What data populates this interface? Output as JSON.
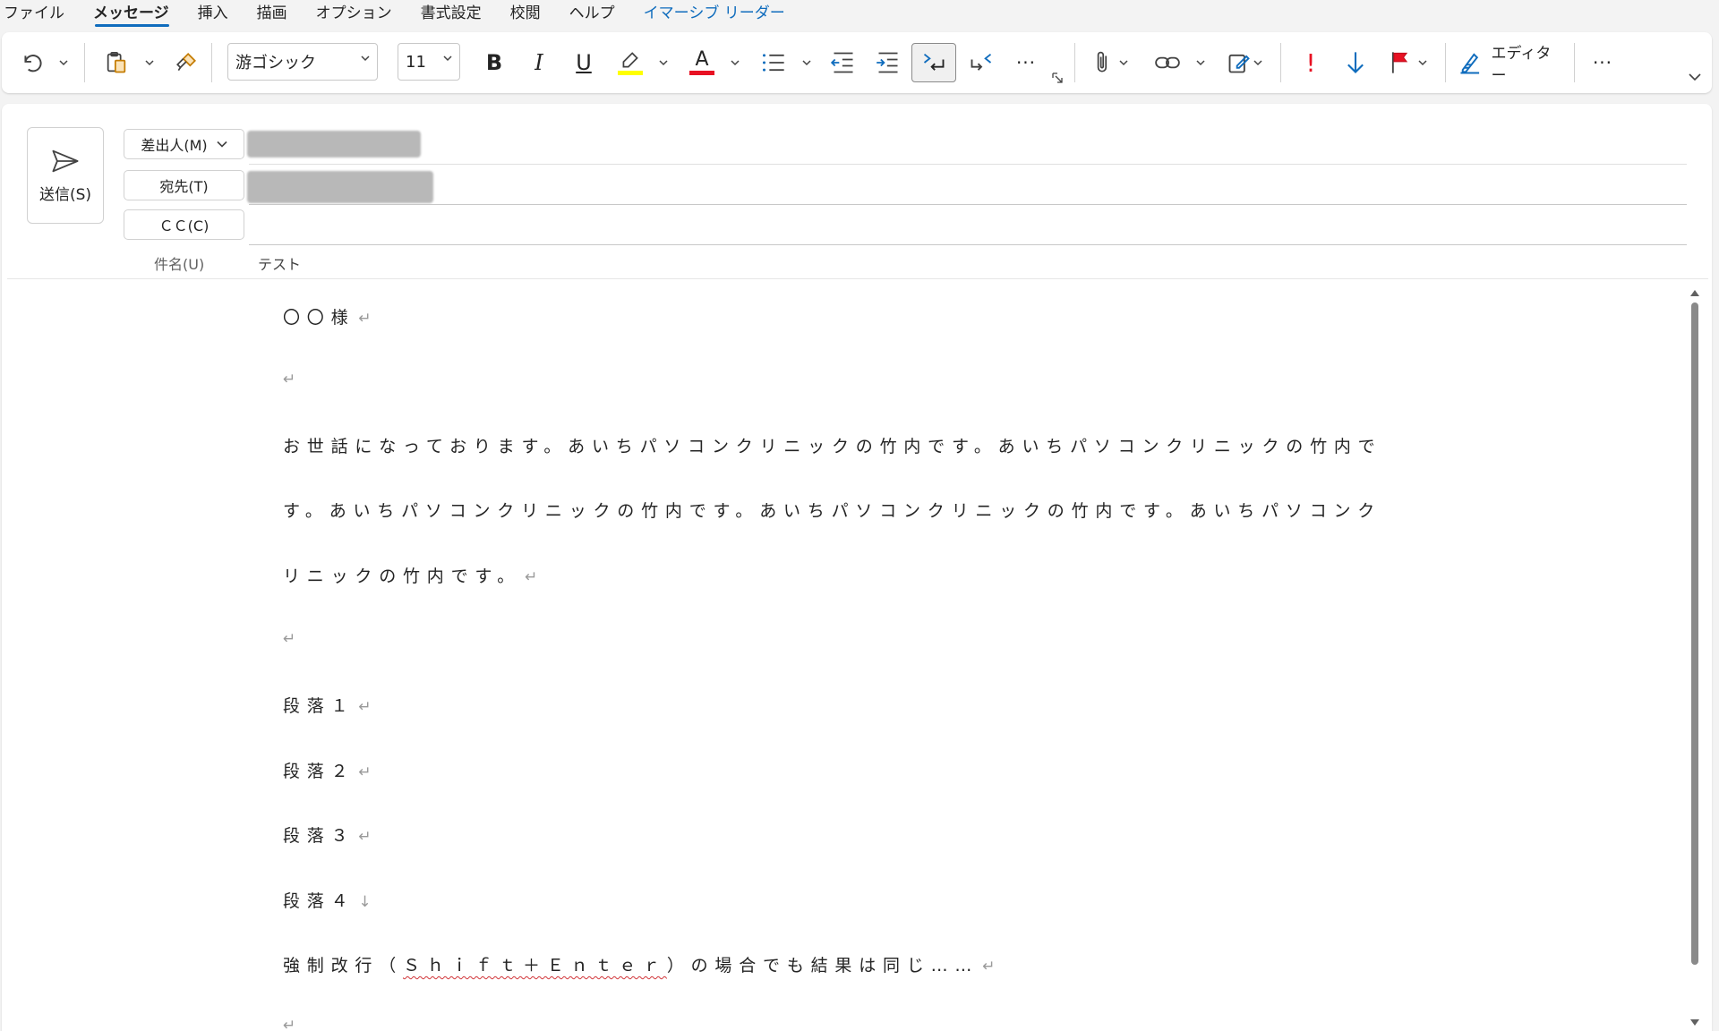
{
  "menu": {
    "tabs": [
      {
        "label": "ファイル"
      },
      {
        "label": "メッセージ"
      },
      {
        "label": "挿入"
      },
      {
        "label": "描画"
      },
      {
        "label": "オプション"
      },
      {
        "label": "書式設定"
      },
      {
        "label": "校閲"
      },
      {
        "label": "ヘルプ"
      },
      {
        "label": "イマーシブ リーダー"
      }
    ],
    "active_tab": "メッセージ"
  },
  "ribbon": {
    "font_name": "游ゴシック",
    "font_size": "11",
    "bold_label": "B",
    "italic_label": "I",
    "underline_label": "U",
    "font_color_label": "A",
    "more_label": "···",
    "importance_high_label": "!",
    "editor_label": "エディター",
    "highlight_color": "#ffff00",
    "font_color": "#e81123",
    "accent_color": "#0f6cbd"
  },
  "compose": {
    "send_label": "送信(S)",
    "from_label": "差出人(M)",
    "to_label": "宛先(T)",
    "cc_label": "ＣＣ(C)",
    "subject_label": "件名(U)",
    "subject_value": "テスト"
  },
  "body": {
    "lines": [
      {
        "text": "〇〇様",
        "mark": "↵"
      },
      {
        "text": "",
        "mark": "↵"
      },
      {
        "text": "お世話になっております。あいちパソコンクリニックの竹内です。あいちパソコンクリニックの竹内で",
        "mark": ""
      },
      {
        "text": "す。あいちパソコンクリニックの竹内です。あいちパソコンクリニックの竹内です。あいちパソコンク",
        "mark": ""
      },
      {
        "text": "リニックの竹内です。",
        "mark": "↵"
      },
      {
        "text": "",
        "mark": "↵"
      },
      {
        "text": "段落１",
        "mark": "↵"
      },
      {
        "text": "段落２",
        "mark": "↵"
      },
      {
        "text": "段落３",
        "mark": "↵"
      },
      {
        "text": "段落４",
        "mark": "↓"
      },
      {
        "text_before": "強制改行（",
        "text_misspelled": "Ｓｈｉｆｔ＋Ｅｎｔｅｒ",
        "text_after": "）の場合でも結果は同じ……",
        "mark": "↵"
      },
      {
        "text": "",
        "mark": "↵"
      }
    ]
  }
}
